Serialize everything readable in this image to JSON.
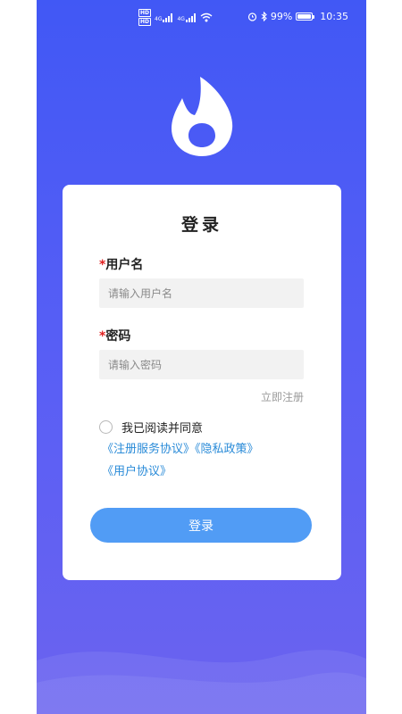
{
  "status_bar": {
    "hd_1": "HD",
    "hd_2": "HD",
    "network_1": "4G",
    "network_2": "4G",
    "battery_percent": "99%",
    "battery_level": 0.99,
    "time": "10:35"
  },
  "login": {
    "title": "登录",
    "username_label": "用户名",
    "username_placeholder": "请输入用户名",
    "password_label": "密码",
    "password_placeholder": "请输入密码",
    "required_mark": "*",
    "register_link": "立即注册",
    "agree_text": "我已阅读并同意",
    "link_service": "《注册服务协议》",
    "link_privacy": "《隐私政策》",
    "link_user": "《用户协议》",
    "submit_label": "登录"
  },
  "colors": {
    "gradient_top": "#4158f5",
    "gradient_bottom": "#6b63ef",
    "button": "#519cf5",
    "link": "#2a8bd8",
    "required": "#e02020"
  },
  "icons": {
    "logo": "flame-drop-logo",
    "alarm": "alarm-icon",
    "bluetooth": "bluetooth-icon",
    "wifi": "wifi-icon",
    "signal": "signal-icon",
    "battery": "battery-icon"
  }
}
